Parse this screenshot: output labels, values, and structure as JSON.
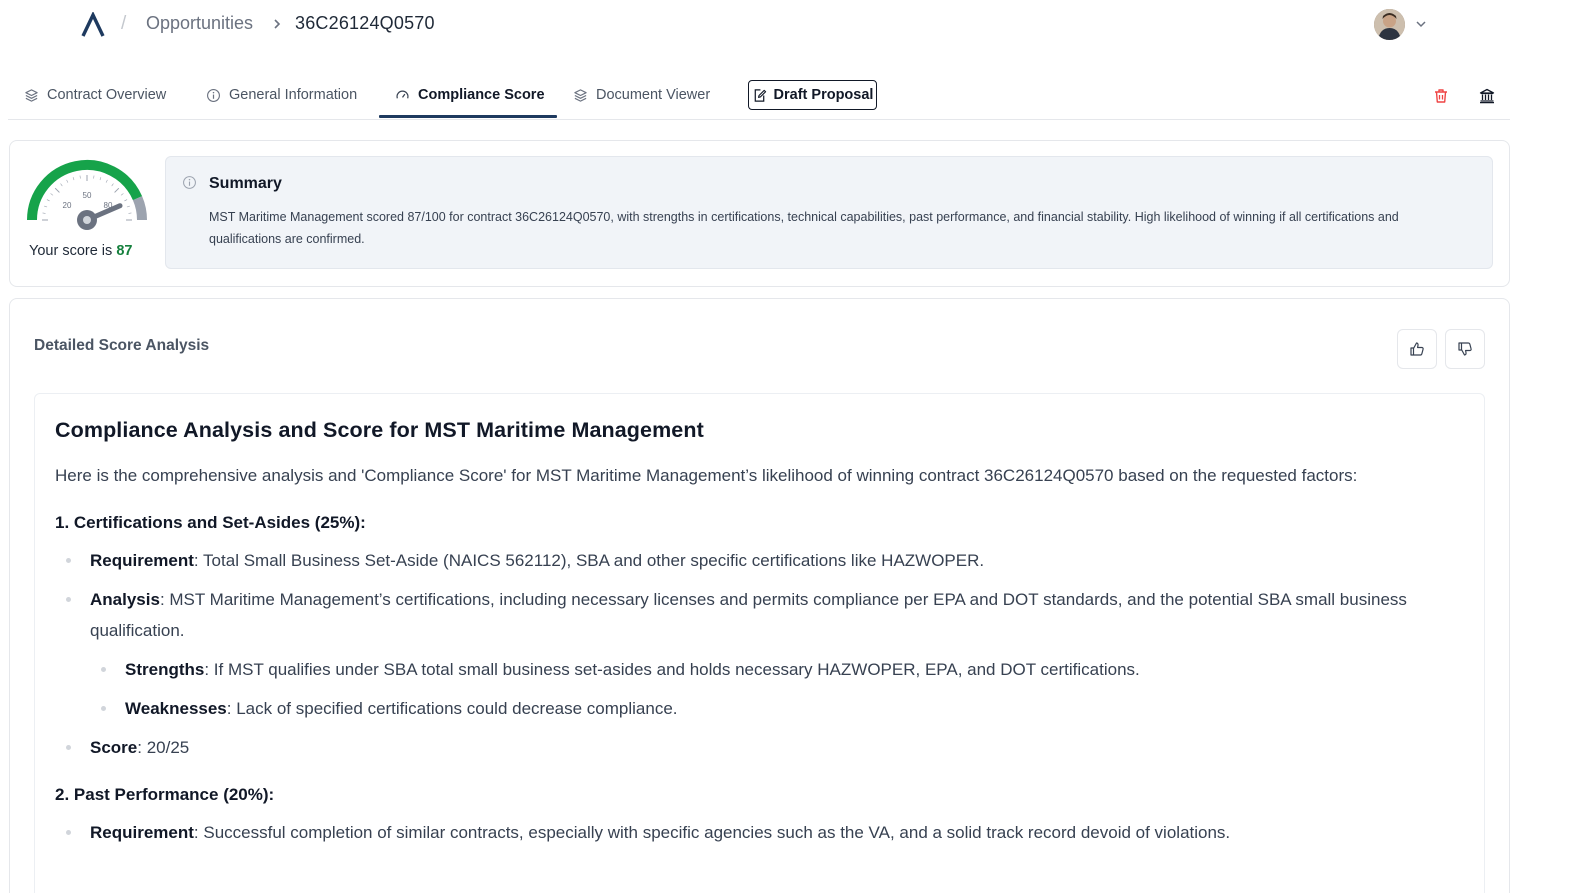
{
  "breadcrumb": {
    "separator": "/",
    "opportunities": "Opportunities",
    "contract_id": "36C26124Q0570"
  },
  "tabs": [
    {
      "label": "Contract Overview",
      "icon": "layers-icon"
    },
    {
      "label": "General Information",
      "icon": "info-icon"
    },
    {
      "label": "Compliance Score",
      "icon": "gauge-icon",
      "active": true
    },
    {
      "label": "Document Viewer",
      "icon": "layers-icon"
    }
  ],
  "draft_button": "Draft Proposal",
  "score": {
    "prefix": "Your score is ",
    "value": "87",
    "gauge_value_fraction": 0.87,
    "gauge_labels": [
      "20",
      "50",
      "80"
    ],
    "color": "#15803d"
  },
  "summary": {
    "title": "Summary",
    "body": "MST Maritime Management scored 87/100 for contract 36C26124Q0570, with strengths in certifications, technical capabilities, past performance, and financial stability. High likelihood of winning if all certifications and qualifications are confirmed."
  },
  "detail": {
    "title": "Detailed Score Analysis"
  },
  "doc": {
    "heading": "Compliance Analysis and Score for MST Maritime Management",
    "intro": "Here is the comprehensive analysis and 'Compliance Score' for MST Maritime Management’s likelihood of winning contract 36C26124Q0570 based on the requested factors:",
    "section1": {
      "title": "1. Certifications and Set-Asides (25%):",
      "req_label": "Requirement",
      "req_text": ": Total Small Business Set-Aside (NAICS 562112), SBA and other specific certifications like HAZWOPER.",
      "analysis_label": "Analysis",
      "analysis_text": ": MST Maritime Management’s certifications, including necessary licenses and permits compliance per EPA and DOT standards, and the potential SBA small business qualification.",
      "strengths_label": "Strengths",
      "strengths_text": ": If MST qualifies under SBA total small business set-asides and holds necessary HAZWOPER, EPA, and DOT certifications.",
      "weak_label": "Weaknesses",
      "weak_text": ": Lack of specified certifications could decrease compliance.",
      "score_label": "Score",
      "score_text": ": 20/25"
    },
    "section2": {
      "title": "2. Past Performance (20%):",
      "req_label": "Requirement",
      "req_text": ": Successful completion of similar contracts, especially with specific agencies such as the VA, and a solid track record devoid of violations."
    }
  },
  "colors": {
    "gauge_green": "#16a34a",
    "gauge_gray": "#9ca3af",
    "trash_red": "#ef4444",
    "tab_underline": "#1e3a5f"
  }
}
